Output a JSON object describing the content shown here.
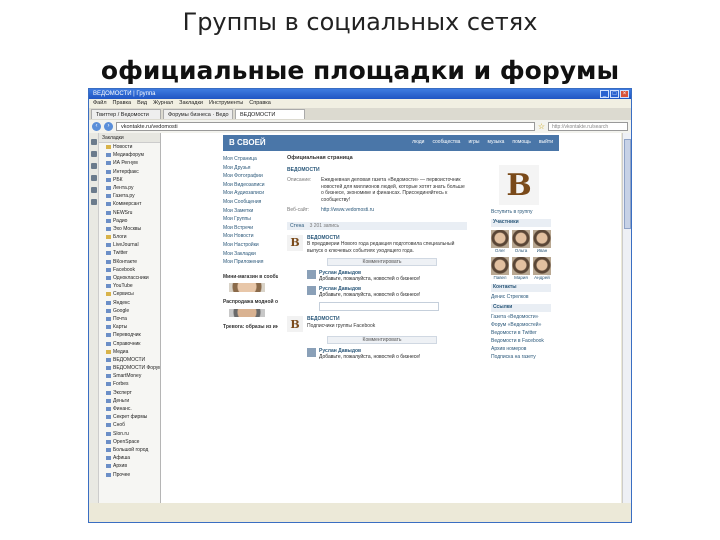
{
  "slide": {
    "title": "Группы в социальных сетях",
    "subtitle": "официальные площадки и форумы"
  },
  "browser": {
    "window_title": "ВЕДОМОСТИ | Группа",
    "window_controls": [
      "_",
      "□",
      "×"
    ],
    "menu": [
      "Файл",
      "Правка",
      "Вид",
      "Журнал",
      "Закладки",
      "Инструменты",
      "Справка"
    ],
    "tabs": [
      {
        "label": "Твиттер / Ведомости"
      },
      {
        "label": "Форумы бизнеса · Ведо"
      },
      {
        "label": "ВЕДОМОСТИ",
        "active": true
      }
    ],
    "address": "vkontakte.ru/vedomosti",
    "search_placeholder": "http://vkontakte.ru/search",
    "back_icon": "arrow-left-icon",
    "forward_icon": "arrow-right-icon"
  },
  "sidebar": {
    "header": "Закладки",
    "items": [
      {
        "label": "Новости",
        "folder": true
      },
      {
        "label": "Медиафорум"
      },
      {
        "label": "ИА Регнум"
      },
      {
        "label": "Интерфакс"
      },
      {
        "label": "РБК"
      },
      {
        "label": "Лента.ру"
      },
      {
        "label": "Газета.ру"
      },
      {
        "label": "Коммерсант"
      },
      {
        "label": "NEWSru"
      },
      {
        "label": "Радио"
      },
      {
        "label": "Эхо Москвы"
      },
      {
        "label": "Блоги",
        "folder": true
      },
      {
        "label": "LiveJournal"
      },
      {
        "label": "Twitter"
      },
      {
        "label": "ВКонтакте"
      },
      {
        "label": "Facebook"
      },
      {
        "label": "Одноклассники"
      },
      {
        "label": "YouTube"
      },
      {
        "label": "Сервисы",
        "folder": true
      },
      {
        "label": "Яндекс"
      },
      {
        "label": "Google"
      },
      {
        "label": "Почта"
      },
      {
        "label": "Карты"
      },
      {
        "label": "Переводчик"
      },
      {
        "label": "Справочник"
      },
      {
        "label": "Медиа",
        "folder": true
      },
      {
        "label": "ВЕДОМОСТИ"
      },
      {
        "label": "ВЕДОМОСТИ Форум"
      },
      {
        "label": "SmartMoney"
      },
      {
        "label": "Forbes"
      },
      {
        "label": "Эксперт"
      },
      {
        "label": "Деньги"
      },
      {
        "label": "Финанс."
      },
      {
        "label": "Секрет фирмы"
      },
      {
        "label": "Сноб"
      },
      {
        "label": "Slon.ru"
      },
      {
        "label": "OpenSpace"
      },
      {
        "label": "Большой город"
      },
      {
        "label": "Афиша"
      },
      {
        "label": "Архив"
      },
      {
        "label": "Прочее"
      }
    ]
  },
  "vk": {
    "logo": "В СВОЕЙ",
    "top_menu": [
      "люди",
      "сообщества",
      "игры",
      "музыка",
      "помощь",
      "выйти"
    ],
    "left_menu": [
      "Моя Страница",
      "Мои Друзья",
      "Мои Фотографии",
      "Мои Видеозаписи",
      "Мои Аудиозаписи",
      "Мои Сообщения",
      "Мои Заметки",
      "Мои Группы",
      "Мои Встречи",
      "Мои Новости",
      "Мои Настройки",
      "Мои Закладки",
      "Мои Приложения"
    ],
    "ad1_title": "Мини-магазин в сообществе",
    "ad2_title": "Распродажа модной одежды",
    "ad3_title": "Тревога: образы из интернет-рекламы",
    "page_title": "Официальная страница",
    "group_name": "ВЕДОМОСТИ",
    "info_label": "Описание:",
    "info_text": "Ежедневная деловая газета «Ведомости» — первоисточник новостей для миллионов людей, которые хотят знать больше о бизнесе, экономике и финансах. Присоединяйтесь к сообществу!",
    "site_label": "Веб-сайт:",
    "site_value": "http://www.vedomosti.ru",
    "wall_head": "Стена",
    "wall_count": "3 201 запись",
    "post1_author": "ВЕДОМОСТИ",
    "post1_text": "В преддверии Нового года редакция подготовила специальный выпуск о ключевых событиях уходящего года.",
    "comment_btn": "Комментировать",
    "comment1_author": "Руслан Давыдов",
    "comment1_text": "Добавьте, пожалуйста, новостей о бизнесе!",
    "comment2_author": "Руслан Давыдов",
    "comment2_text": "Добавьте, пожалуйста, новостей о бизнесе!",
    "post2_author": "ВЕДОМОСТИ",
    "post2_text": "Подписчики группы Facebook",
    "comment3_author": "Руслан Давыдов",
    "comment3_text": "Добавьте, пожалуйста, новостей о бизнесе!",
    "right_caption": "Вступить в группу",
    "members_head": "Участники",
    "members": [
      "Олег",
      "Ольга",
      "Иван",
      "Павел",
      "Мария",
      "Андрей"
    ],
    "contacts_head": "Контакты",
    "contact_name": "Денис Стрелков",
    "links_head": "Ссылки",
    "links": [
      "Газета «Ведомости»",
      "Форум «Ведомостей»",
      "Ведомости в Twitter",
      "Ведомости в Facebook",
      "Архив номеров",
      "Подписка на газету"
    ]
  }
}
